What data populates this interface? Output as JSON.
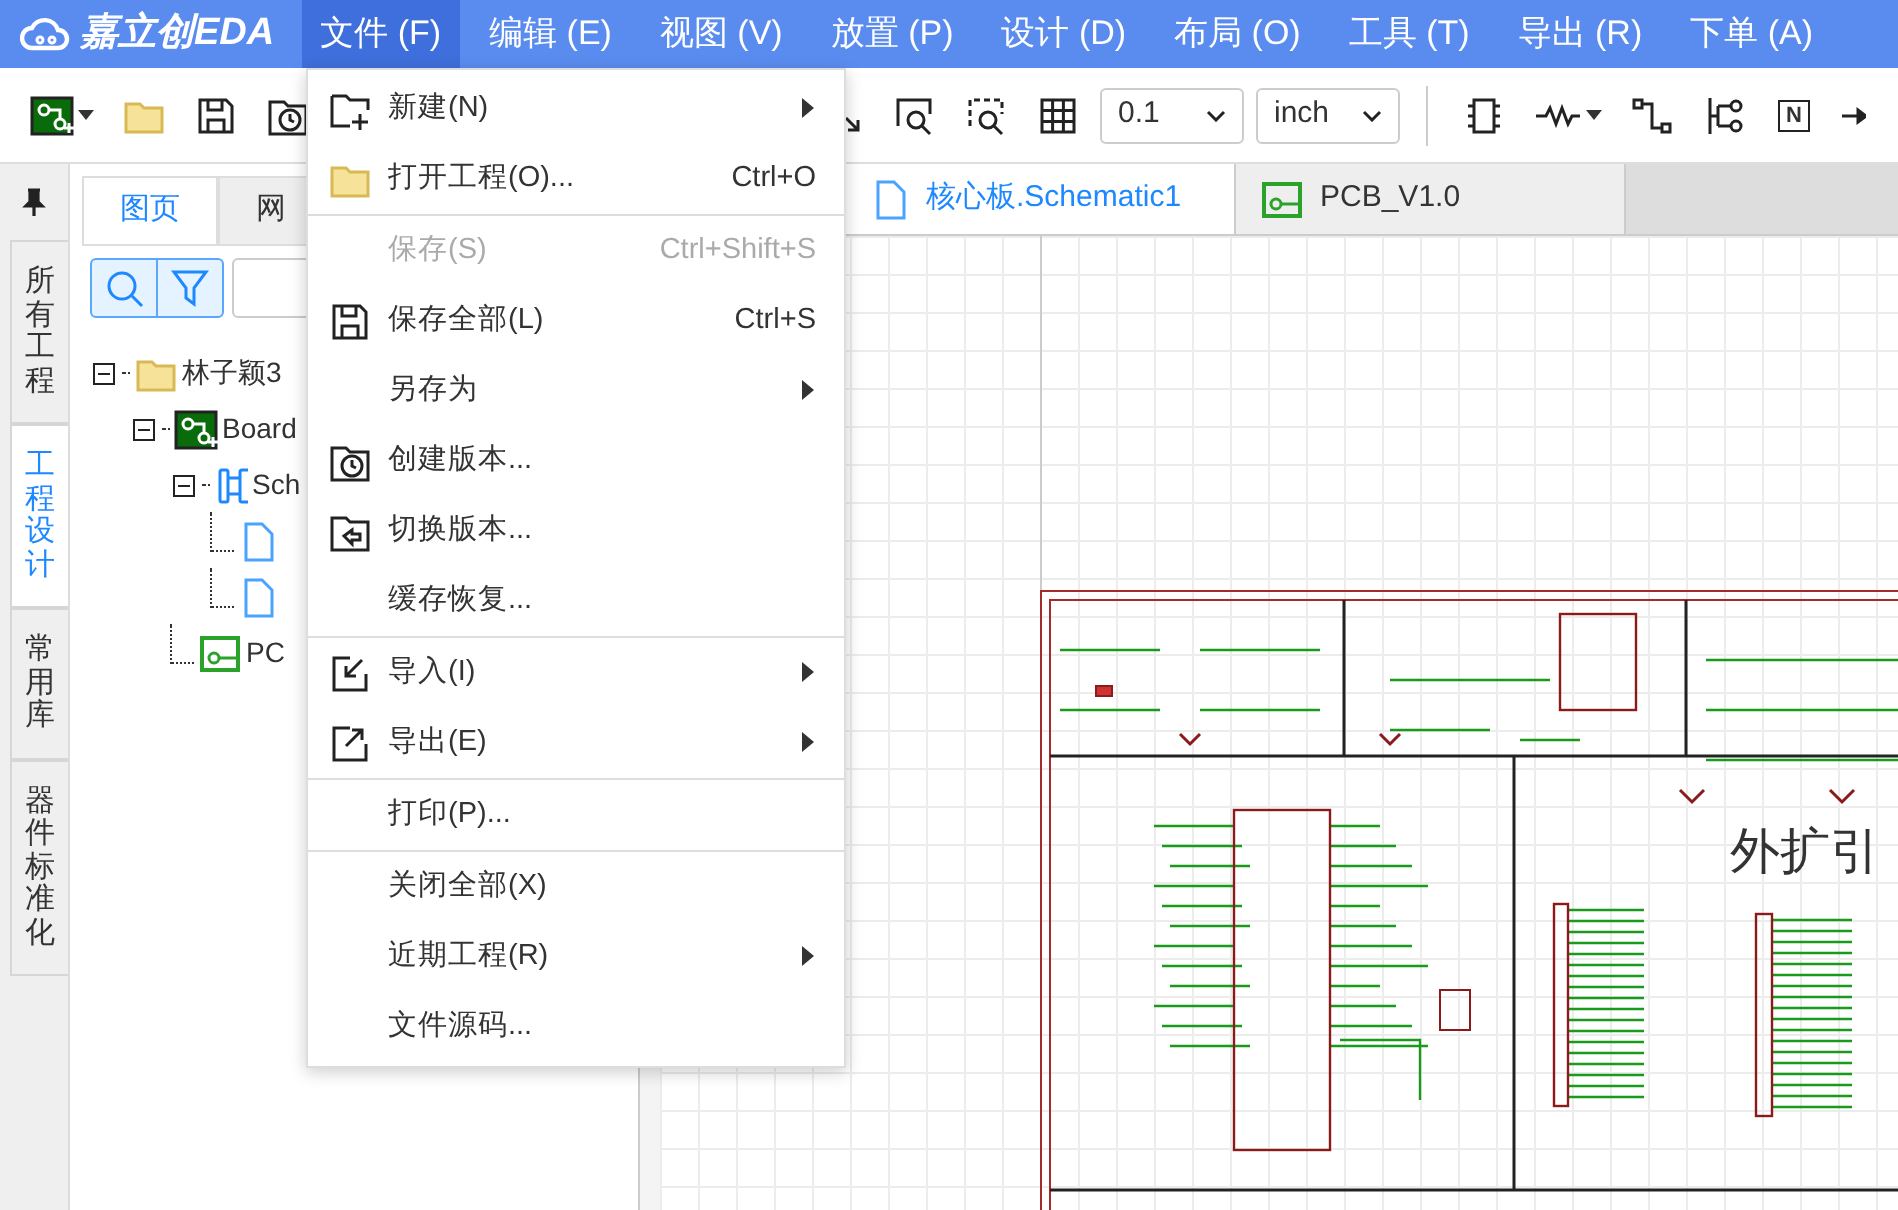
{
  "app": {
    "logo": "嘉立创EDA"
  },
  "menubar": [
    {
      "label": "文件 (F)",
      "selected": true
    },
    {
      "label": "编辑 (E)",
      "selected": false
    },
    {
      "label": "视图 (V)",
      "selected": false
    },
    {
      "label": "放置 (P)",
      "selected": false
    },
    {
      "label": "设计 (D)",
      "selected": false
    },
    {
      "label": "布局 (O)",
      "selected": false
    },
    {
      "label": "工具 (T)",
      "selected": false
    },
    {
      "label": "导出 (R)",
      "selected": false
    },
    {
      "label": "下单 (A)",
      "selected": false
    }
  ],
  "toolbar_left": [
    {
      "kind": "menu-icon"
    },
    {
      "kind": "icon"
    },
    {
      "kind": "icon"
    },
    {
      "kind": "icon"
    }
  ],
  "toolbar_right": [
    {
      "kind": "icon"
    },
    {
      "kind": "icon"
    },
    {
      "kind": "icon"
    },
    {
      "kind": "icon"
    },
    {
      "kind": "select",
      "value": "0.1"
    },
    {
      "kind": "select",
      "value": "inch"
    },
    {
      "kind": "divider"
    },
    {
      "kind": "icon"
    },
    {
      "kind": "menu-icon"
    },
    {
      "kind": "icon"
    },
    {
      "kind": "icon"
    },
    {
      "kind": "label",
      "text": "N"
    },
    {
      "kind": "icon"
    }
  ],
  "side_tabs": [
    {
      "label": "所有工程",
      "selected": false
    },
    {
      "label": "工程设计",
      "selected": true
    },
    {
      "label": "常用库",
      "selected": false
    },
    {
      "label": "器件标准化",
      "selected": false
    }
  ],
  "panel": {
    "tabs": [
      {
        "label": "图页",
        "selected": true
      },
      {
        "label": "网",
        "selected": false
      }
    ],
    "tree": [
      {
        "label": "林子颖3",
        "kind": "folder",
        "expanded": true,
        "children": [
          {
            "label": "Board",
            "kind": "board",
            "expanded": true,
            "children": [
              {
                "label": "Sch",
                "kind": "schematic",
                "expanded": true,
                "children": [
                  {
                    "kind": "page"
                  },
                  {
                    "kind": "page"
                  }
                ]
              },
              {
                "label": "PC",
                "kind": "pcb"
              }
            ]
          }
        ]
      }
    ]
  },
  "file_menu": [
    {
      "label": "新建(N)",
      "submenu": true,
      "disabled": false,
      "separator_after": false
    },
    {
      "label": "打开工程(O)...",
      "shortcut": "Ctrl+O",
      "submenu": false,
      "disabled": false,
      "separator_after": true
    },
    {
      "label": "保存(S)",
      "shortcut": "Ctrl+Shift+S",
      "submenu": false,
      "disabled": true,
      "separator_after": false
    },
    {
      "label": "保存全部(L)",
      "shortcut": "Ctrl+S",
      "submenu": false,
      "disabled": false,
      "separator_after": false
    },
    {
      "label": "另存为",
      "submenu": true,
      "disabled": false,
      "separator_after": false
    },
    {
      "label": "创建版本...",
      "submenu": false,
      "disabled": false,
      "separator_after": false
    },
    {
      "label": "切换版本...",
      "submenu": false,
      "disabled": false,
      "separator_after": false
    },
    {
      "label": "缓存恢复...",
      "submenu": false,
      "disabled": false,
      "separator_after": true
    },
    {
      "label": "导入(I)",
      "submenu": true,
      "disabled": false,
      "separator_after": false
    },
    {
      "label": "导出(E)",
      "submenu": true,
      "disabled": false,
      "separator_after": true
    },
    {
      "label": "打印(P)...",
      "submenu": false,
      "disabled": false,
      "separator_after": true
    },
    {
      "label": "关闭全部(X)",
      "submenu": false,
      "disabled": false,
      "separator_after": false
    },
    {
      "label": "近期工程(R)",
      "submenu": true,
      "disabled": false,
      "separator_after": false
    },
    {
      "label": "文件源码...",
      "submenu": false,
      "disabled": false,
      "separator_after": false
    }
  ],
  "doc_tabs": [
    {
      "label": "核心板.Schematic1",
      "kind": "schematic",
      "selected": true
    },
    {
      "label": "PCB_V1.0",
      "kind": "pcb",
      "selected": false
    }
  ],
  "canvas": {
    "sheet_title": "外扩引"
  }
}
